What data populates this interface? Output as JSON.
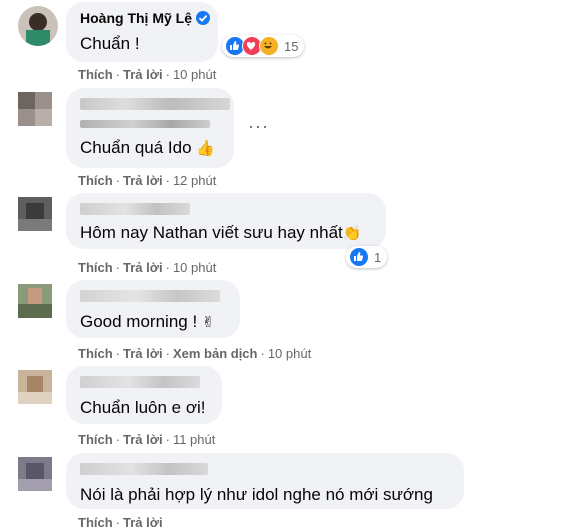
{
  "actions": {
    "like": "Thích",
    "reply": "Trả lời",
    "translate": "Xem bản dịch"
  },
  "comments": [
    {
      "author": "Hoàng Thị Mỹ Lệ",
      "text": "Chuẩn !",
      "time": "10 phút",
      "reaction_count": "15",
      "reaction_icons": [
        "like-icon",
        "love-icon",
        "haha-icon"
      ],
      "verified": true
    },
    {
      "author": "",
      "text": "Chuẩn quá Ido",
      "emoji": "👍",
      "time": "12 phút",
      "more_options": "···"
    },
    {
      "author": "",
      "text": "Hôm nay Nathan viết sưu hay nhất",
      "emoji": "👏",
      "time": "10 phút",
      "reaction_count": "1",
      "reaction_icons": [
        "like-icon"
      ]
    },
    {
      "author": "",
      "text": "Good morning !",
      "emoji": "✌",
      "time": "10 phút"
    },
    {
      "author": "",
      "text": "Chuẩn luôn e ơi!",
      "time": "11 phút"
    },
    {
      "author": "",
      "text": "Nói là phải hợp lý như idol nghe nó mới sướng",
      "time": ""
    }
  ],
  "colors": {
    "bubble": "#f0f2f5",
    "meta_text": "#65676b",
    "like_blue": "#1877f2",
    "love_red": "#f33e58",
    "haha_yellow": "#f7b125"
  }
}
